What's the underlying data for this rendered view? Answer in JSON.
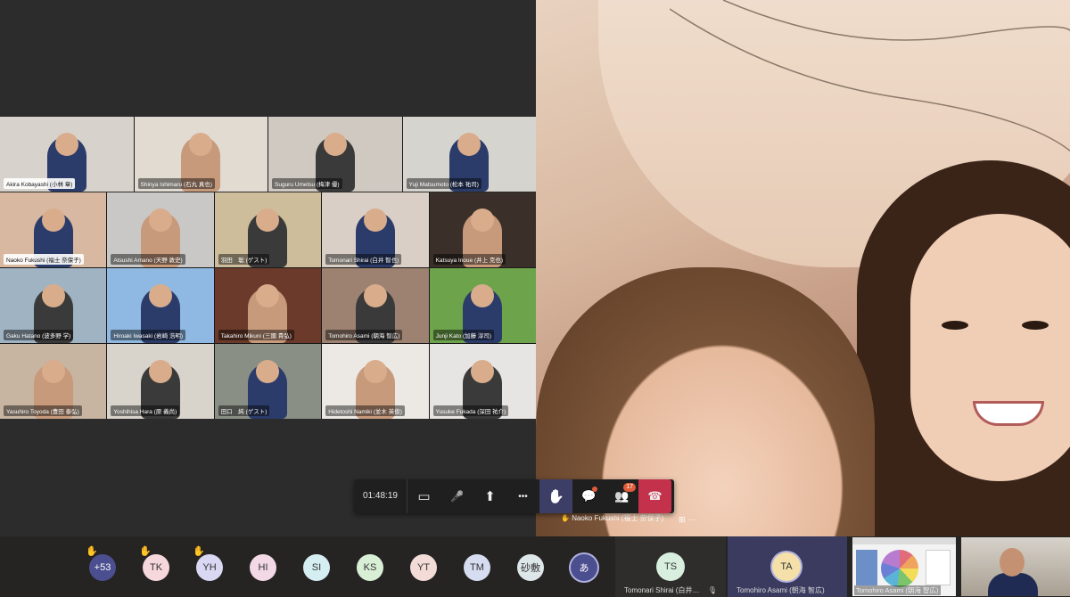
{
  "timer": "01:48:19",
  "top_row": [
    {
      "name": "Akira Kobayashi (小林 章)",
      "bg": "#d7d2cc"
    },
    {
      "name": "Shinya Ishimaru (石丸 真也)",
      "bg": "#e1dbd2"
    },
    {
      "name": "Suguru Umetsu (梅津 優)",
      "bg": "#cfc9c1"
    },
    {
      "name": "Yuji Matsumoto (松本 祐司)",
      "bg": "#d6d4cf"
    }
  ],
  "grid": [
    {
      "name": "Naoko Fukushi (福士 奈保子)",
      "bg": "#d8b8a0",
      "light": true
    },
    {
      "name": "Atsushi Amano (天野 敦史)",
      "bg": "#c9c8c6"
    },
    {
      "name": "羽田　聡 (ゲスト)",
      "bg": "#cdbd9b"
    },
    {
      "name": "Tomonari Shirai (白井 智也)",
      "bg": "#d9cfc6"
    },
    {
      "name": "Katsuya Inoue (井上 克也)",
      "bg": "#3a2f29"
    },
    {
      "name": "Gaku Hatano (波多野 学)",
      "bg": "#9fb3c3"
    },
    {
      "name": "Hiroaki Iwasaki (岩崎 浩明)",
      "bg": "#8fb9e2"
    },
    {
      "name": "Takahiro Mikuni (三國 貴弘)",
      "bg": "#6b3a2a"
    },
    {
      "name": "Tomohiro Asami (朝海 智広)",
      "bg": "#9d8271"
    },
    {
      "name": "Junji Kato (加藤 淳司)",
      "bg": "#6da34a"
    },
    {
      "name": "Yasuhiro Toyoda (豊田 泰弘)",
      "bg": "#c7b4a1"
    },
    {
      "name": "Yoshihisa Hara (原 義尚)",
      "bg": "#d8d3cb"
    },
    {
      "name": "田口　純 (ゲスト)",
      "bg": "#8a8f86"
    },
    {
      "name": "Hidetoshi Namiki (並木 英俊)",
      "bg": "#ece9e4"
    },
    {
      "name": "Yusuke Fukada (深田 祐介)",
      "bg": "#e7e5e3"
    }
  ],
  "spotlight": {
    "name": "Naoko Fukushi (福士 奈保子)"
  },
  "controls": {
    "camera": "▭",
    "mic": "🎤",
    "share": "⬆",
    "more": "•••",
    "hand": "✋",
    "chat": "💬",
    "people": "👥",
    "people_count": "17",
    "hangup": "☎"
  },
  "bottom_avatars": [
    {
      "label": "+53",
      "bg": "#4b4e8f",
      "fg": "#ffffff",
      "raised": true
    },
    {
      "label": "TK",
      "bg": "#f6d7dc",
      "fg": "#333",
      "raised": true
    },
    {
      "label": "YH",
      "bg": "#d9d7f2",
      "fg": "#333",
      "raised": true
    },
    {
      "label": "HI",
      "bg": "#f3d8e6",
      "fg": "#333",
      "raised": false
    },
    {
      "label": "SI",
      "bg": "#d5eef2",
      "fg": "#333",
      "raised": false
    },
    {
      "label": "KS",
      "bg": "#d8efd6",
      "fg": "#333",
      "raised": false
    },
    {
      "label": "YT",
      "bg": "#f3dcd7",
      "fg": "#333",
      "raised": false
    },
    {
      "label": "TM",
      "bg": "#d7ddf0",
      "fg": "#333",
      "raised": false
    },
    {
      "label": "砂敷",
      "bg": "#dde6e8",
      "fg": "#333",
      "raised": false
    },
    {
      "label": "あ",
      "bg": "#4b4e8f",
      "fg": "#ffffff",
      "raised": false
    }
  ],
  "bottom_tiles": [
    {
      "initials": "TS",
      "name": "Tomonari Shirai (白井…",
      "bg": "#d8efe0"
    },
    {
      "initials": "TA",
      "name": "Tomohiro Asami (朝海 智広)",
      "bg": "#f4e0a8"
    }
  ],
  "share_name": "Tomohiro Asami (朝海 智広)"
}
